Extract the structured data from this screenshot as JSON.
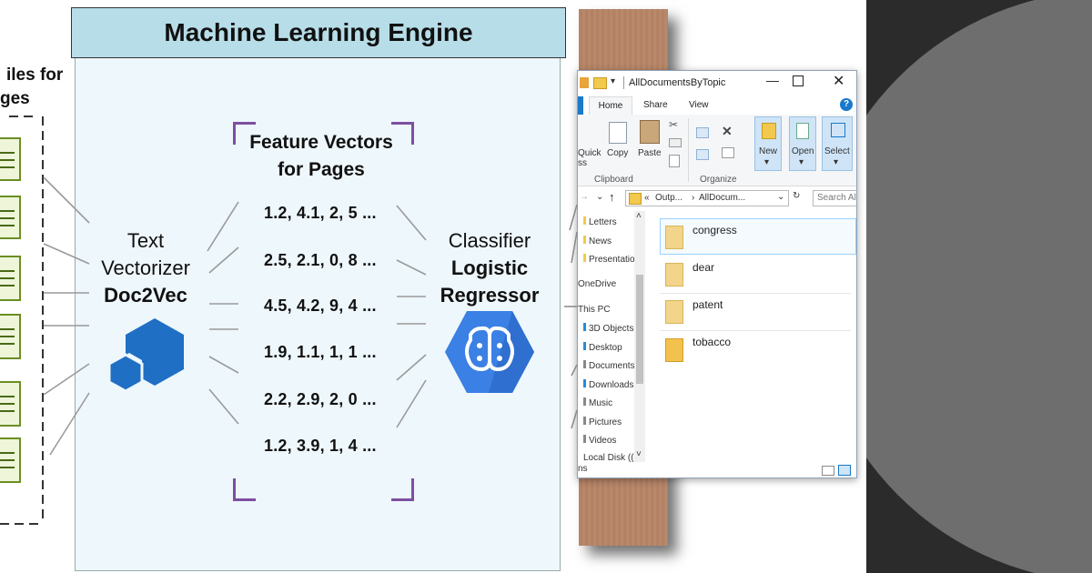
{
  "diagram": {
    "left_partial_title": [
      "iles for",
      "ges"
    ],
    "title": "Machine Learning Engine",
    "vectorizer": {
      "line1": "Text",
      "line2": "Vectorizer",
      "line3": "Doc2Vec"
    },
    "feature_title": [
      "Feature Vectors",
      "for Pages"
    ],
    "vectors": [
      "1.2, 4.1, 2, 5 ...",
      "2.5, 2.1, 0, 8 ...",
      "4.5, 4.2, 9, 4 ...",
      "1.9, 1.1, 1, 1 ...",
      "2.2, 2.9, 2, 0 ...",
      "1.2, 3.9, 1, 4 ..."
    ],
    "classifier": {
      "line1": "Classifier",
      "line2": "Logistic",
      "line3": "Regressor"
    },
    "colors": {
      "panel": "#eef7fc",
      "title_bar": "#b7dde8",
      "bracket": "#7d4fa0",
      "doc2vec": "#1f6fc4",
      "brain_hex": "#3b80e4"
    }
  },
  "explorer": {
    "title": "AllDocumentsByTopic",
    "tabs": [
      "Home",
      "Share",
      "View"
    ],
    "ribbon": {
      "quick": "Quick",
      "quick2": "ss",
      "copy": "Copy",
      "paste": "Paste",
      "new": "New",
      "open": "Open",
      "select": "Select",
      "group_clipboard": "Clipboard",
      "group_organize": "Organize"
    },
    "path": [
      "«",
      "Outp...",
      "›",
      "AllDocum..."
    ],
    "search_placeholder": "Search Al",
    "nav": [
      "Letters",
      "News",
      "Presentation",
      "OneDrive",
      "This PC",
      "3D Objects",
      "Desktop",
      "Documents",
      "Downloads",
      "Music",
      "Pictures",
      "Videos",
      "Local Disk (("
    ],
    "folders": [
      "congress",
      "dear",
      "patent",
      "tobacco"
    ],
    "status": "ns",
    "icons": [
      "folder-icon",
      "pin-icon",
      "minimize-icon",
      "maximize-icon",
      "close-icon",
      "help-icon",
      "refresh-icon",
      "up-arrow-icon",
      "scissors-icon",
      "copy-icon",
      "paste-icon",
      "delete-icon",
      "new-folder-icon",
      "properties-icon",
      "select-all-icon",
      "details-view-icon",
      "large-icons-view-icon"
    ]
  }
}
